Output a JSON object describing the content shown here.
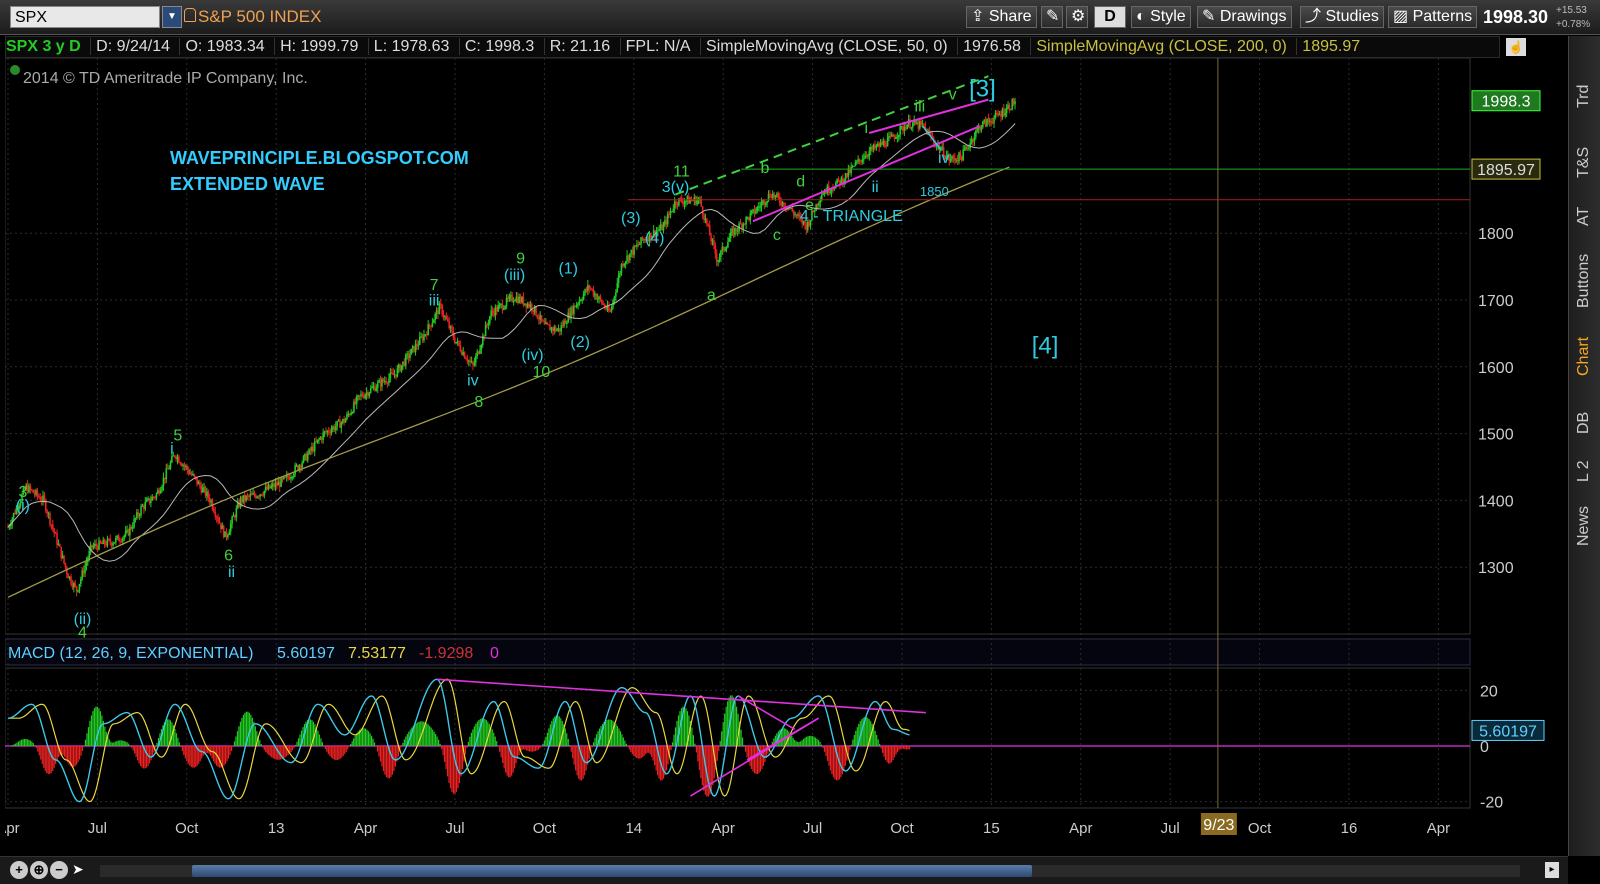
{
  "toolbar": {
    "symbol": "SPX",
    "symbol_name": "S&P 500 INDEX",
    "share": "Share",
    "style": "Style",
    "drawings": "Drawings",
    "studies": "Studies",
    "patterns": "Patterns",
    "d_badge": "D",
    "last_price": "1998.30",
    "change_pts": "+15.53",
    "change_pct": "+0.78%"
  },
  "infobar": {
    "title": "SPX 3 y D",
    "date": "D: 9/24/14",
    "open": "O: 1983.34",
    "high": "H: 1999.79",
    "low": "L: 1978.63",
    "close": "C: 1998.3",
    "range": "R: 21.16",
    "fpl": "FPL: N/A",
    "sma50_label": "SimpleMovingAvg (CLOSE, 50, 0)",
    "sma50_value": "1976.58",
    "sma200_label": "SimpleMovingAvg (CLOSE, 200, 0)",
    "sma200_value": "1895.97"
  },
  "side_tabs": [
    "Trd",
    "T&S",
    "AT",
    "Buttons",
    "Chart",
    "DB",
    "L 2",
    "News"
  ],
  "colors": {
    "up": "#22cc22",
    "down": "#ee2222",
    "sma50": "#b8b8b8",
    "sma200": "#a39a4a",
    "wave_green": "#3ed23e",
    "wave_cyan": "#2ecce0",
    "magenta": "#e030e0",
    "macd": "#3cc8e8",
    "signal": "#e8d840",
    "grid": "#2c2c2c",
    "text_blog": "#33ccff"
  },
  "chart_data": [
    {
      "type": "candlestick",
      "copyright": "2014 © TD Ameritrade IP Company, Inc.",
      "blog_title": "WAVEPRINCIPLE.BLOGSPOT.COM",
      "blog_subtitle": "EXTENDED WAVE",
      "ylim": [
        1200,
        2100
      ],
      "y_ticks": [
        1300,
        1400,
        1500,
        1600,
        1700,
        1800
      ],
      "x_ticks": [
        "Apr",
        "Jul",
        "Oct",
        "13",
        "Apr",
        "Jul",
        "Oct",
        "14",
        "Apr",
        "Jul",
        "Oct",
        "15",
        "Apr",
        "Jul",
        "Oct",
        "16",
        "Apr"
      ],
      "x_tick_months": [
        0,
        3,
        6,
        9,
        12,
        15,
        18,
        21,
        24,
        27,
        30,
        33,
        36,
        39,
        42,
        45,
        48
      ],
      "price_path": [
        [
          0,
          1360
        ],
        [
          0.6,
          1420
        ],
        [
          1.2,
          1400
        ],
        [
          2,
          1290
        ],
        [
          2.3,
          1265
        ],
        [
          2.8,
          1330
        ],
        [
          3.6,
          1340
        ],
        [
          4,
          1350
        ],
        [
          4.5,
          1390
        ],
        [
          5,
          1410
        ],
        [
          5.6,
          1470
        ],
        [
          6.3,
          1430
        ],
        [
          6.8,
          1400
        ],
        [
          7.3,
          1345
        ],
        [
          7.8,
          1400
        ],
        [
          8.4,
          1410
        ],
        [
          9.3,
          1430
        ],
        [
          10,
          1465
        ],
        [
          10.6,
          1500
        ],
        [
          11.3,
          1520
        ],
        [
          11.8,
          1555
        ],
        [
          12.3,
          1570
        ],
        [
          13,
          1590
        ],
        [
          13.5,
          1620
        ],
        [
          14,
          1650
        ],
        [
          14.5,
          1690
        ],
        [
          15,
          1640
        ],
        [
          15.6,
          1600
        ],
        [
          16.2,
          1680
        ],
        [
          17,
          1705
        ],
        [
          17.6,
          1690
        ],
        [
          18,
          1660
        ],
        [
          18.5,
          1655
        ],
        [
          19,
          1690
        ],
        [
          19.5,
          1720
        ],
        [
          20.2,
          1680
        ],
        [
          20.6,
          1755
        ],
        [
          21.3,
          1790
        ],
        [
          22,
          1810
        ],
        [
          22.4,
          1848
        ],
        [
          23.2,
          1850
        ],
        [
          23.8,
          1760
        ],
        [
          24.3,
          1800
        ],
        [
          25,
          1830
        ],
        [
          25.6,
          1860
        ],
        [
          26.2,
          1838
        ],
        [
          26.8,
          1810
        ],
        [
          27.3,
          1860
        ],
        [
          28,
          1880
        ],
        [
          28.8,
          1920
        ],
        [
          29.6,
          1940
        ],
        [
          30.2,
          1965
        ],
        [
          30.7,
          1960
        ],
        [
          31.2,
          1930
        ],
        [
          31.6,
          1910
        ],
        [
          32,
          1915
        ],
        [
          32.6,
          1960
        ],
        [
          33.2,
          1975
        ],
        [
          33.8,
          1998
        ]
      ],
      "sma50_value": 1976.58,
      "sma200_value": 1895.97,
      "hlines": [
        {
          "value": 1895.97,
          "color": "#22aa22",
          "label": "1895.97"
        },
        {
          "value": 1850,
          "color": "#aa2222",
          "label": "1850"
        }
      ],
      "last_value": 1998.3,
      "date_marker": "9/23",
      "annotations": [
        {
          "text": "3",
          "m": 0.5,
          "v": 1405,
          "color": "green"
        },
        {
          "text": "(i)",
          "m": 0.5,
          "v": 1385,
          "color": "cyan"
        },
        {
          "text": "(ii)",
          "m": 2.5,
          "v": 1215,
          "color": "cyan"
        },
        {
          "text": "4",
          "m": 2.5,
          "v": 1195,
          "color": "green"
        },
        {
          "text": "5",
          "m": 5.7,
          "v": 1490,
          "color": "green"
        },
        {
          "text": "i",
          "m": 5.5,
          "v": 1470,
          "color": "cyan"
        },
        {
          "text": "6",
          "m": 7.4,
          "v": 1310,
          "color": "green"
        },
        {
          "text": "ii",
          "m": 7.5,
          "v": 1285,
          "color": "cyan"
        },
        {
          "text": "7",
          "m": 14.3,
          "v": 1715,
          "color": "green"
        },
        {
          "text": "iii",
          "m": 14.3,
          "v": 1692,
          "color": "cyan"
        },
        {
          "text": "iv",
          "m": 15.6,
          "v": 1572,
          "color": "cyan"
        },
        {
          "text": "8",
          "m": 15.8,
          "v": 1540,
          "color": "green"
        },
        {
          "text": "9",
          "m": 17.2,
          "v": 1755,
          "color": "green"
        },
        {
          "text": "(iii)",
          "m": 17.0,
          "v": 1730,
          "color": "cyan"
        },
        {
          "text": "(iv)",
          "m": 17.6,
          "v": 1610,
          "color": "cyan"
        },
        {
          "text": "10",
          "m": 17.9,
          "v": 1585,
          "color": "green"
        },
        {
          "text": "(1)",
          "m": 18.8,
          "v": 1740,
          "color": "cyan"
        },
        {
          "text": "(2)",
          "m": 19.2,
          "v": 1630,
          "color": "cyan"
        },
        {
          "text": "(3)",
          "m": 20.9,
          "v": 1815,
          "color": "cyan"
        },
        {
          "text": "(4)",
          "m": 21.7,
          "v": 1785,
          "color": "cyan"
        },
        {
          "text": "11",
          "m": 22.6,
          "v": 1885,
          "color": "green"
        },
        {
          "text": "3(v)",
          "m": 22.4,
          "v": 1862,
          "color": "cyan"
        },
        {
          "text": "a",
          "m": 23.6,
          "v": 1700,
          "color": "green"
        },
        {
          "text": "b",
          "m": 25.4,
          "v": 1890,
          "color": "green"
        },
        {
          "text": "c",
          "m": 25.8,
          "v": 1790,
          "color": "green"
        },
        {
          "text": "d",
          "m": 26.6,
          "v": 1870,
          "color": "green"
        },
        {
          "text": "e",
          "m": 26.9,
          "v": 1835,
          "color": "green"
        },
        {
          "text": "4 - TRIANGLE",
          "m": 28.3,
          "v": 1818,
          "color": "cyan"
        },
        {
          "text": "i",
          "m": 28.8,
          "v": 1950,
          "color": "green"
        },
        {
          "text": "ii",
          "m": 29.1,
          "v": 1862,
          "color": "cyan"
        },
        {
          "text": "iii",
          "m": 30.6,
          "v": 1982,
          "color": "green"
        },
        {
          "text": "iv",
          "m": 31.4,
          "v": 1905,
          "color": "cyan"
        },
        {
          "text": "v",
          "m": 31.7,
          "v": 2000,
          "color": "green"
        },
        {
          "text": "[3]",
          "m": 32.7,
          "v": 2005,
          "color": "cyan"
        },
        {
          "text": "[4]",
          "m": 34.8,
          "v": 1620,
          "color": "cyan"
        }
      ]
    },
    {
      "type": "macd",
      "label": "MACD (12, 26, 9, EXPONENTIAL)",
      "value": "5.60197",
      "avg": "7.53177",
      "diff": "-1.9298",
      "zero_label": "0",
      "ylim": [
        -25,
        25
      ],
      "y_ticks": [
        -20,
        0,
        20
      ],
      "macd_path": [
        [
          0,
          10
        ],
        [
          0.8,
          15
        ],
        [
          1.6,
          -5
        ],
        [
          2.4,
          -20
        ],
        [
          3.2,
          8
        ],
        [
          4,
          12
        ],
        [
          4.8,
          -4
        ],
        [
          5.6,
          15
        ],
        [
          6.5,
          -2
        ],
        [
          7.4,
          -19
        ],
        [
          8.3,
          8
        ],
        [
          9.5,
          -6
        ],
        [
          10.4,
          15
        ],
        [
          11.3,
          4
        ],
        [
          12.2,
          18
        ],
        [
          13,
          -5
        ],
        [
          14.4,
          24
        ],
        [
          15.2,
          -10
        ],
        [
          16.3,
          16
        ],
        [
          17,
          -4
        ],
        [
          17.8,
          -8
        ],
        [
          18.7,
          16
        ],
        [
          19.4,
          -6
        ],
        [
          20.6,
          21
        ],
        [
          21.4,
          12
        ],
        [
          22.1,
          -10
        ],
        [
          22.9,
          18
        ],
        [
          23.7,
          -18
        ],
        [
          24.5,
          18
        ],
        [
          25.4,
          -4
        ],
        [
          26.3,
          10
        ],
        [
          27.2,
          18
        ],
        [
          28.1,
          -9
        ],
        [
          29.1,
          16
        ],
        [
          29.7,
          6
        ],
        [
          30.3,
          4
        ]
      ],
      "trend_lines": "magenta"
    }
  ]
}
